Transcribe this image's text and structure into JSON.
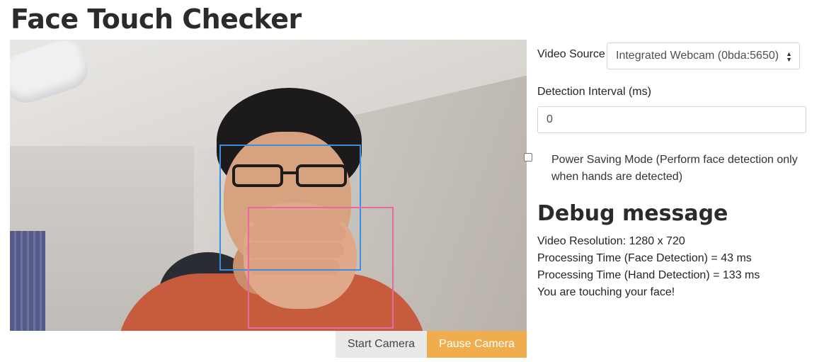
{
  "page": {
    "title": "Face Touch Checker"
  },
  "camera": {
    "boxes": {
      "face": "#3c8ee0",
      "hand": "#e8699e"
    }
  },
  "controls": {
    "start_label": "Start Camera",
    "pause_label": "Pause Camera",
    "accent": "#f0ad4e"
  },
  "settings": {
    "video_source_label": "Video Source",
    "video_source_value": "Integrated Webcam (0bda:5650)",
    "interval_label": "Detection Interval (ms)",
    "interval_value": "0",
    "power_saving_label": "Power Saving Mode (Perform face detection only when hands are detected)",
    "power_saving_checked": false
  },
  "debug": {
    "heading": "Debug message",
    "lines": [
      "Video Resolution: 1280 x 720",
      "Processing Time (Face Detection) = 43 ms",
      "Processing Time (Hand Detection) = 133 ms",
      "You are touching your face!"
    ]
  }
}
